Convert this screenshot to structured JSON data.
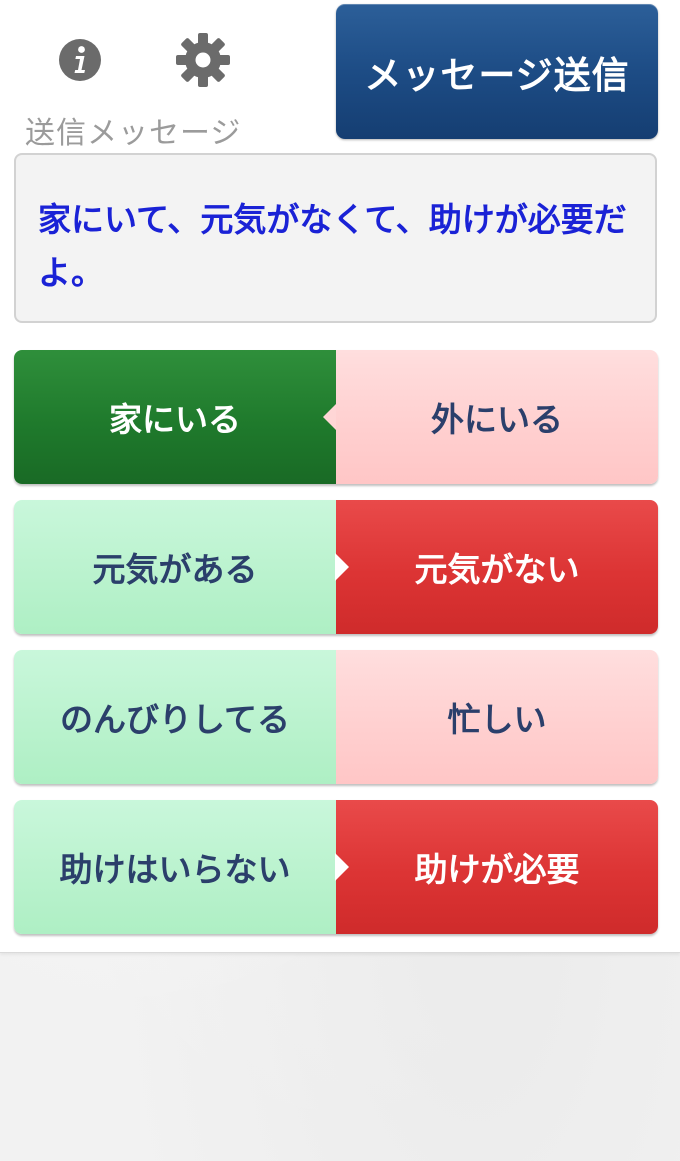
{
  "header": {
    "info_icon": "info-icon",
    "gear_icon": "gear-icon",
    "sent_message_label": "送信メッセージ",
    "send_button_label": "メッセージ送信"
  },
  "message": {
    "text": "家にいて、元気がなくて、助けが必要だよ。",
    "color": "#1a22d6"
  },
  "toggles": [
    {
      "left": "家にいる",
      "right": "外にいる",
      "selected": "left"
    },
    {
      "left": "元気がある",
      "right": "元気がない",
      "selected": "right"
    },
    {
      "left": "のんびりしてる",
      "right": "忙しい",
      "selected": "none"
    },
    {
      "left": "助けはいらない",
      "right": "助けが必要",
      "selected": "right"
    }
  ],
  "colors": {
    "send_button": "#1d4c85",
    "selected_green": "#1f7a2c",
    "selected_red": "#dc3434",
    "unselected_green": "#b9f2cd",
    "unselected_red": "#ffcfcf",
    "toggle_text": "#2b3f6b"
  }
}
